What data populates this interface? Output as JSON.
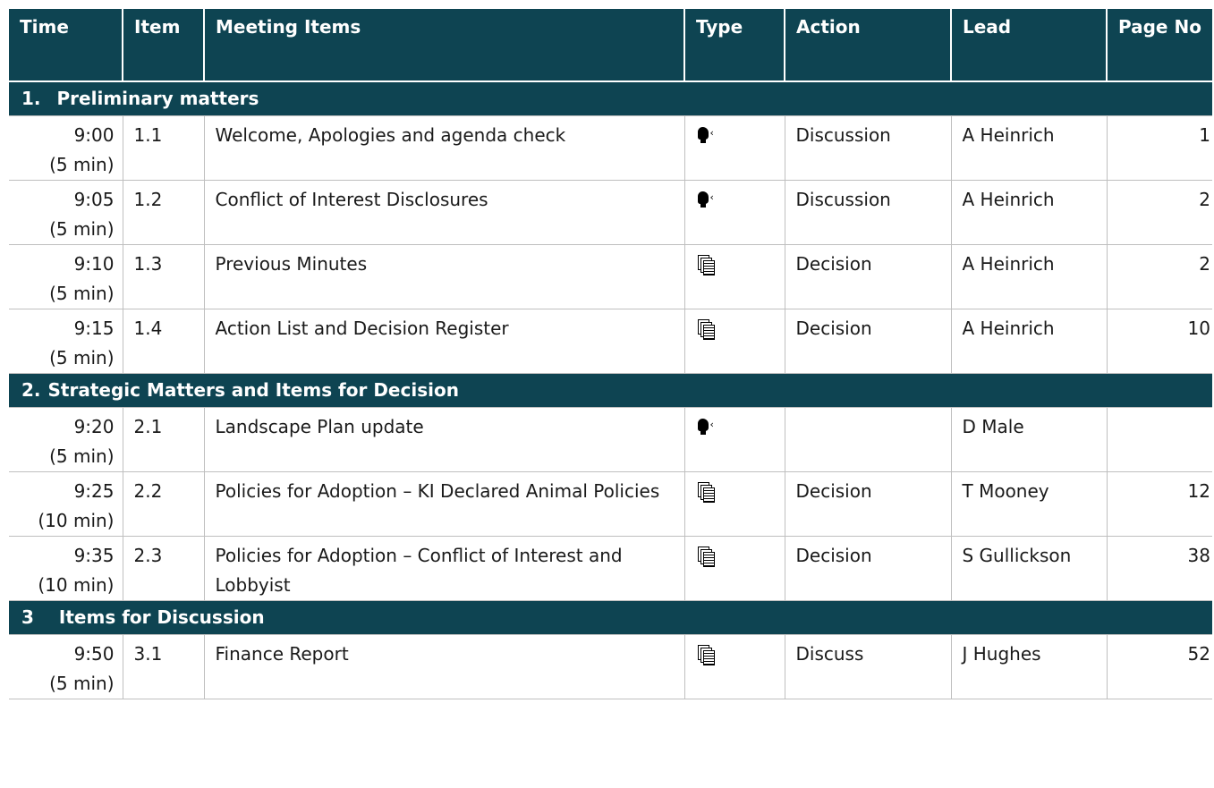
{
  "headers": {
    "time": "Time",
    "item": "Item",
    "meeting_items": "Meeting Items",
    "type": "Type",
    "action": "Action",
    "lead": "Lead",
    "page_no": "Page No"
  },
  "sections": [
    {
      "number": "1.",
      "title": "Preliminary matters",
      "rows": [
        {
          "time": "9:00",
          "duration": "(5 min)",
          "item": "1.1",
          "meeting_item": "Welcome, Apologies and agenda check",
          "type_icon": "speaking-head-icon",
          "action": "Discussion",
          "lead": "A Heinrich",
          "page": "1"
        },
        {
          "time": "9:05",
          "duration": "(5 min)",
          "item": "1.2",
          "meeting_item": "Conflict of Interest Disclosures",
          "type_icon": "speaking-head-icon",
          "action": "Discussion",
          "lead": "A Heinrich",
          "page": "2"
        },
        {
          "time": "9:10",
          "duration": "(5 min)",
          "item": "1.3",
          "meeting_item": "Previous Minutes",
          "type_icon": "documents-icon",
          "action": "Decision",
          "lead": "A Heinrich",
          "page": "2"
        },
        {
          "time": "9:15",
          "duration": "(5 min)",
          "item": "1.4",
          "meeting_item": "Action List and Decision Register",
          "type_icon": "documents-icon",
          "action": "Decision",
          "lead": "A Heinrich",
          "page": "10"
        }
      ]
    },
    {
      "number": "2.",
      "title": "Strategic Matters and Items for Decision",
      "rows": [
        {
          "time": "9:20",
          "duration": "(5 min)",
          "item": "2.1",
          "meeting_item": "Landscape Plan update",
          "type_icon": "speaking-head-icon",
          "action": "",
          "lead": "D Male",
          "page": ""
        },
        {
          "time": "9:25",
          "duration": "(10 min)",
          "item": "2.2",
          "meeting_item": "Policies for Adoption –  KI Declared Animal Policies",
          "type_icon": "documents-icon",
          "action": "Decision",
          "lead": "T Mooney",
          "page": "12"
        },
        {
          "time": "9:35",
          "duration": "(10 min)",
          "item": "2.3",
          "meeting_item": "Policies for Adoption – Conflict of Interest and Lobbyist",
          "type_icon": "documents-icon",
          "action": "Decision",
          "lead": "S Gullickson",
          "page": "38"
        }
      ]
    },
    {
      "number": "3",
      "title": "Items for Discussion",
      "rows": [
        {
          "time": "9:50",
          "duration": "(5 min)",
          "item": "3.1",
          "meeting_item": "Finance Report",
          "type_icon": "documents-icon",
          "action": "Discuss",
          "lead": "J Hughes",
          "page": "52"
        }
      ]
    }
  ],
  "colors": {
    "header_bg": "#0e4452",
    "header_text": "#ffffff",
    "grid": "#bfbfbf"
  }
}
